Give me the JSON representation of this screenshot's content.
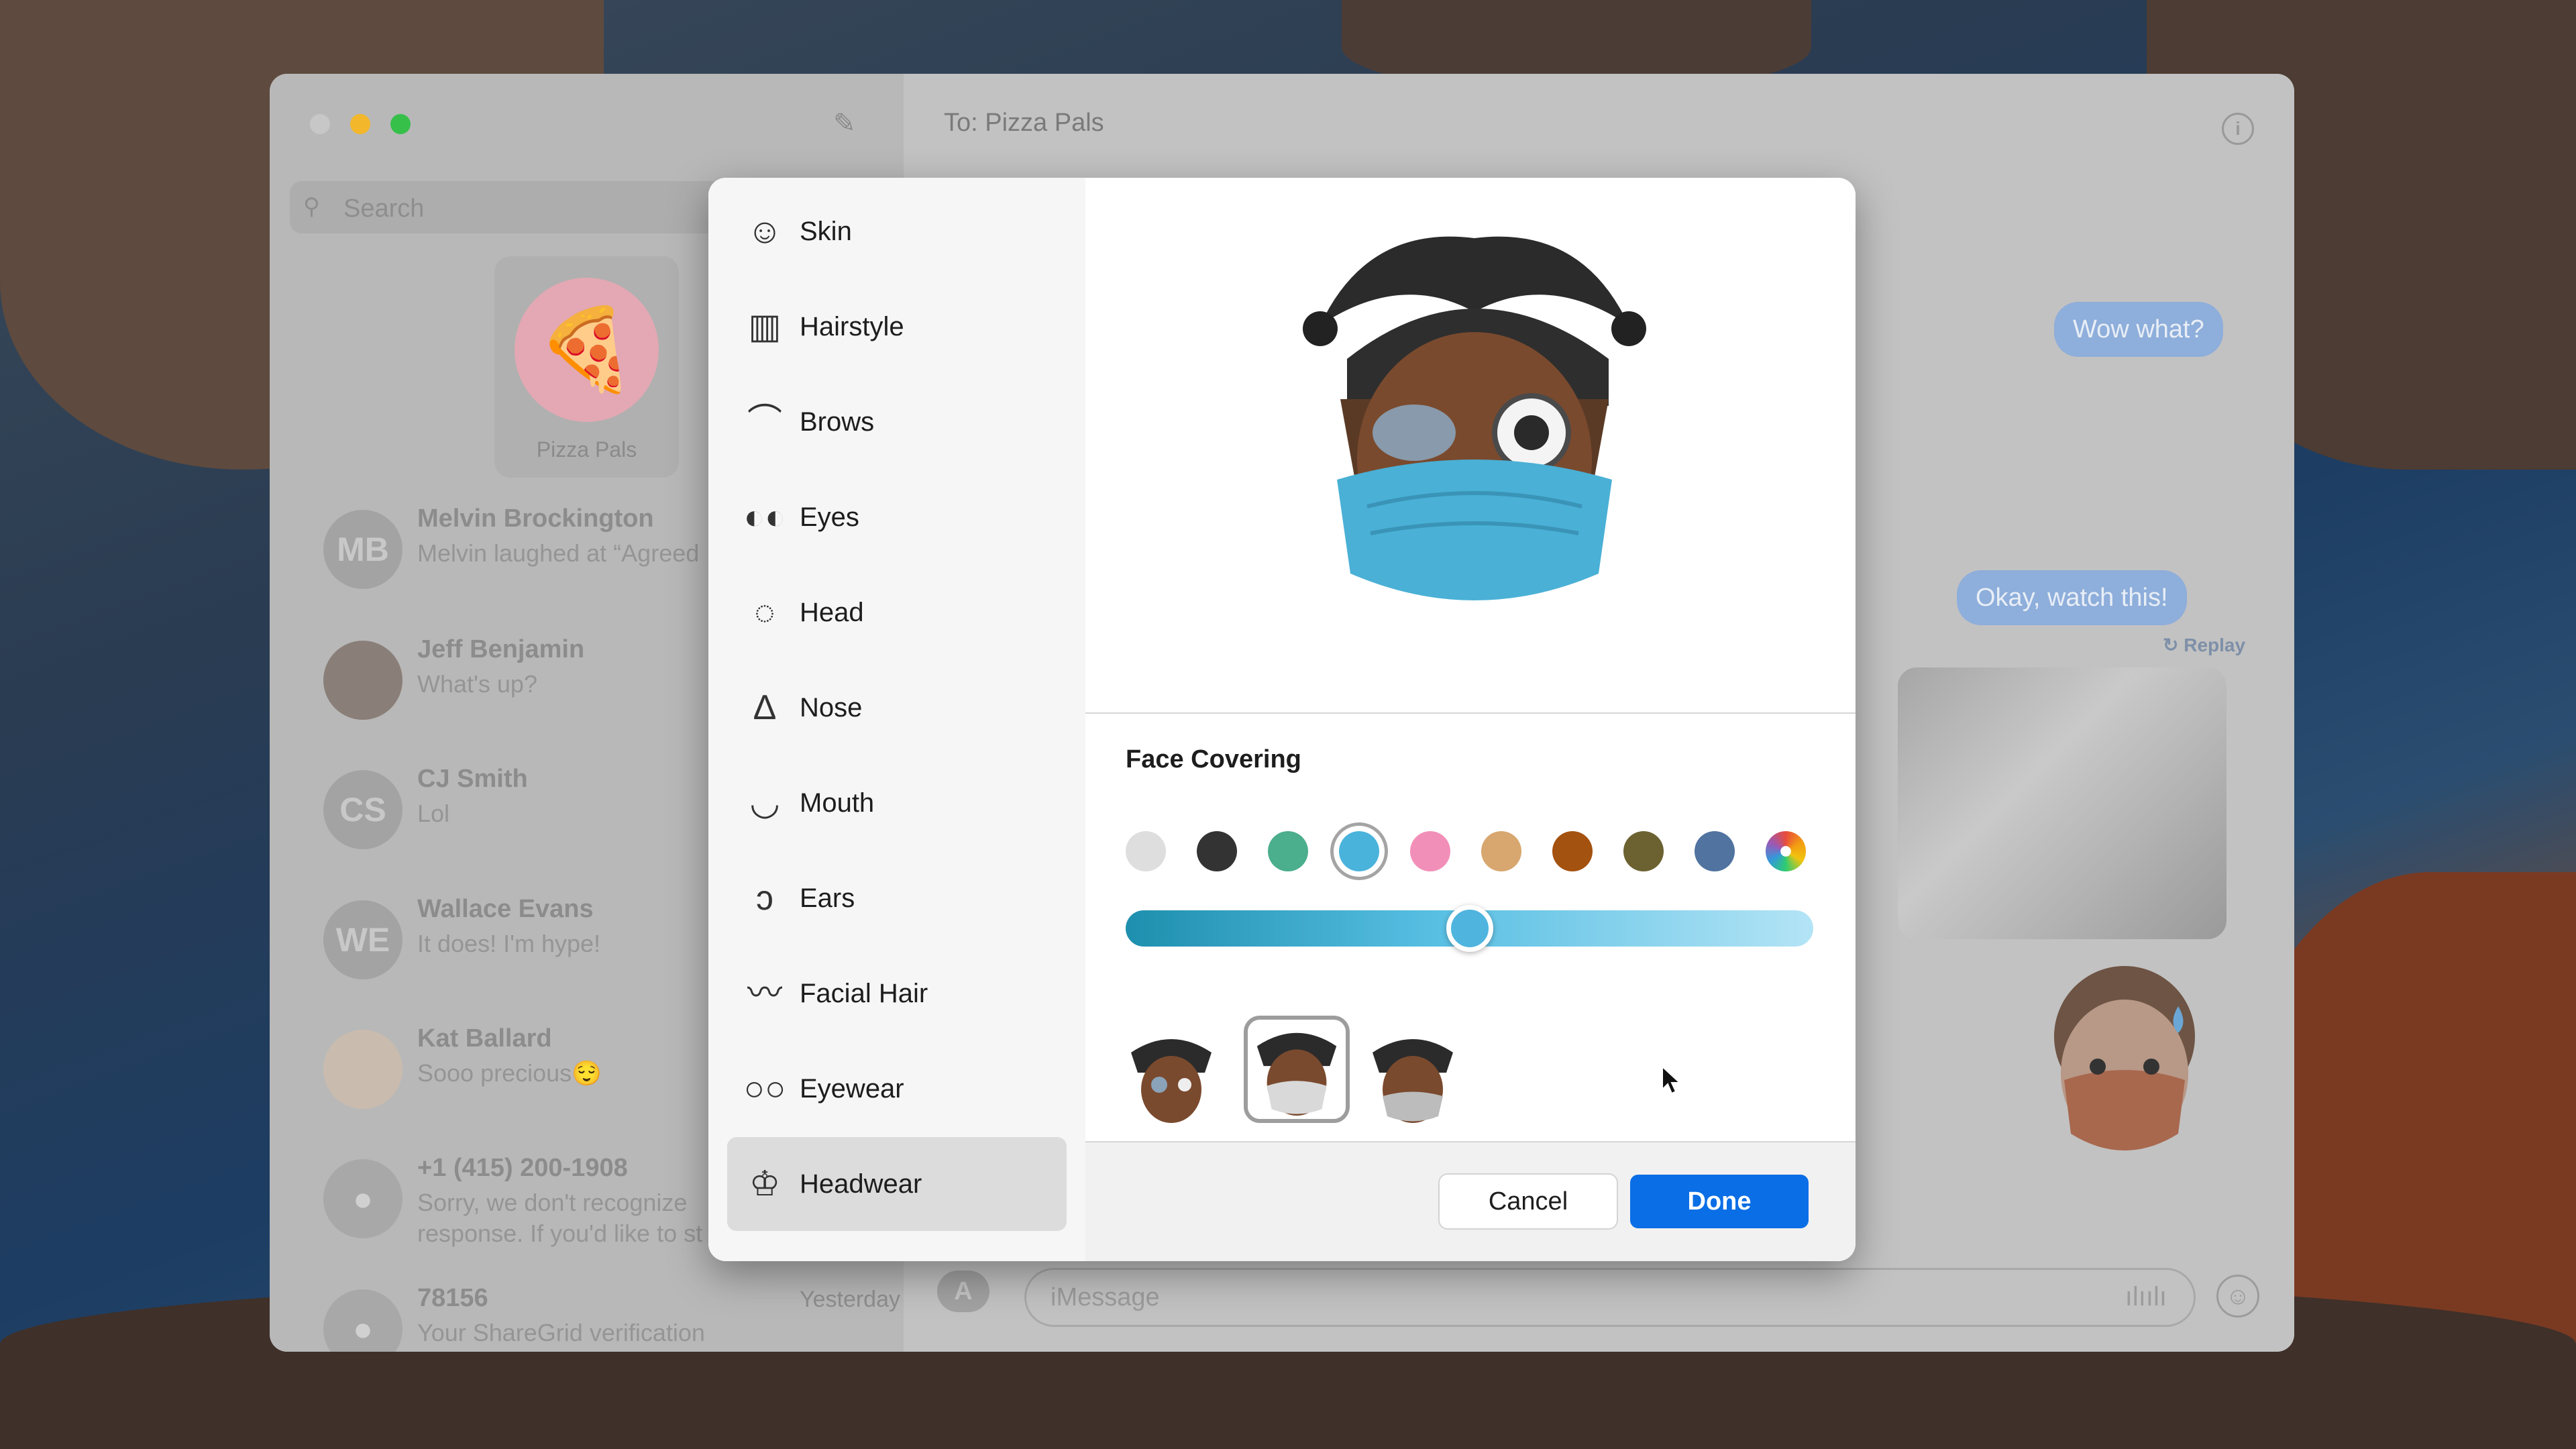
{
  "sidebar": {
    "search_placeholder": "Search",
    "pinned": {
      "name": "Pizza Pals",
      "avatar_emoji": "🍕"
    },
    "conversations": [
      {
        "initials": "MB",
        "name": "Melvin Brockington",
        "preview": "Melvin laughed at “Agreed",
        "time": ""
      },
      {
        "initials": "",
        "name": "Jeff Benjamin",
        "preview": "What's up?",
        "time": ""
      },
      {
        "initials": "CS",
        "name": "CJ Smith",
        "preview": "Lol",
        "time": ""
      },
      {
        "initials": "WE",
        "name": "Wallace Evans",
        "preview": "It does! I'm hype!",
        "time": ""
      },
      {
        "initials": "",
        "name": "Kat Ballard",
        "preview": "Sooo precious😌",
        "time": ""
      },
      {
        "initials": "",
        "name": "+1 (415) 200-1908",
        "preview": "Sorry, we don't recognize response. If you'd like to st",
        "time": ""
      },
      {
        "initials": "",
        "name": "78156",
        "preview": "Your ShareGrid verification code is:",
        "time": "Yesterday"
      }
    ]
  },
  "conversation": {
    "to_label": "To:",
    "recipient": "Pizza Pals",
    "messages": [
      {
        "text": "Wow what?"
      },
      {
        "text": "Okay, watch this!"
      }
    ],
    "replay_label": "Replay",
    "input_placeholder": "iMessage"
  },
  "memoji_editor": {
    "categories": [
      {
        "label": "Skin",
        "icon": "smiley-face-icon"
      },
      {
        "label": "Hairstyle",
        "icon": "comb-icon"
      },
      {
        "label": "Brows",
        "icon": "eyebrow-icon"
      },
      {
        "label": "Eyes",
        "icon": "eyes-icon"
      },
      {
        "label": "Head",
        "icon": "head-outline-icon"
      },
      {
        "label": "Nose",
        "icon": "nose-icon"
      },
      {
        "label": "Mouth",
        "icon": "lips-icon"
      },
      {
        "label": "Ears",
        "icon": "ear-icon"
      },
      {
        "label": "Facial Hair",
        "icon": "mustache-icon"
      },
      {
        "label": "Eyewear",
        "icon": "glasses-icon"
      },
      {
        "label": "Headwear",
        "icon": "crown-icon",
        "selected": true
      }
    ],
    "section_title": "Face Covering",
    "swatches": [
      "#dedede",
      "#333333",
      "#4bae8d",
      "#4ab3dc",
      "#f28fb8",
      "#d7a76f",
      "#a4520f",
      "#6c6231",
      "#50739f",
      "multicolor"
    ],
    "selected_swatch_index": 3,
    "slider_value": 0.5,
    "variants": 3,
    "selected_variant_index": 1,
    "cancel_label": "Cancel",
    "done_label": "Done"
  },
  "colors": {
    "accent": "#0a6ee6",
    "bubble": "#8eaedb"
  }
}
